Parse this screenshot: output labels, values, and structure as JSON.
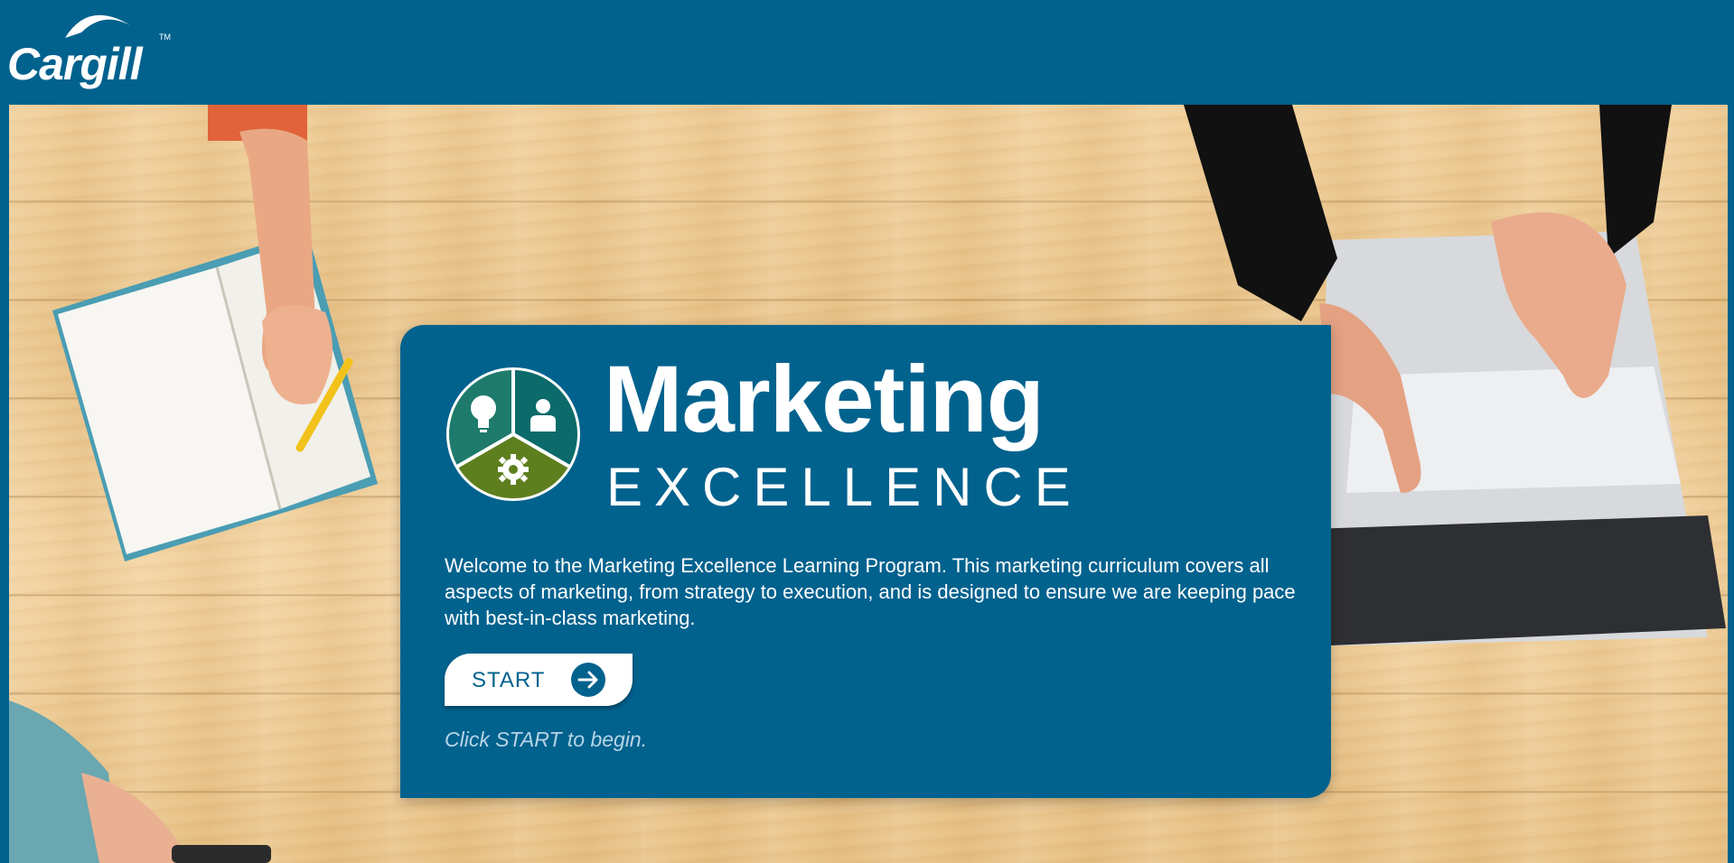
{
  "brand": {
    "logo_text": "Cargill",
    "trademark": "TM"
  },
  "hero": {
    "title": "Marketing",
    "subtitle": "EXCELLENCE",
    "welcome_text": "Welcome to the Marketing Excellence Learning Program. This marketing curriculum covers all aspects of marketing, from strategy to execution, and is designed to ensure we are keeping pace with best-in-class marketing.",
    "start_label": "START",
    "hint": "Click START to begin."
  },
  "icons": {
    "logo_segments": [
      "lightbulb-icon",
      "person-icon",
      "gear-icon"
    ],
    "start": "arrow-right-icon"
  },
  "colors": {
    "brand_blue": "#01628e",
    "segment_teal": "#1e7b6c",
    "segment_dark_teal": "#0c6a6a",
    "segment_green": "#5e7f1e",
    "button_bg": "#ffffff",
    "hint_text": "#b7d4e6"
  }
}
